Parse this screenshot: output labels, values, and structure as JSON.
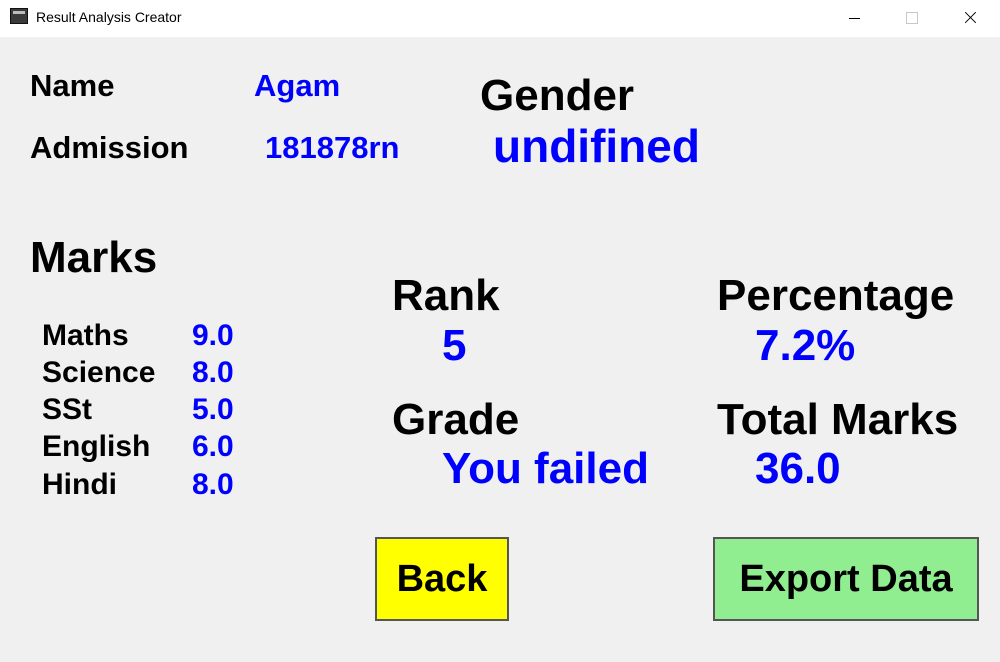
{
  "window": {
    "title": "Result Analysis Creator"
  },
  "student": {
    "name_label": "Name",
    "name_value": "Agam",
    "admission_label": "Admission",
    "admission_value": "181878rn",
    "gender_label": "Gender",
    "gender_value": "undifined"
  },
  "marks": {
    "heading": "Marks",
    "subjects": [
      {
        "name": "Maths",
        "score": "9.0"
      },
      {
        "name": "Science",
        "score": "8.0"
      },
      {
        "name": "SSt",
        "score": "5.0"
      },
      {
        "name": "English",
        "score": "6.0"
      },
      {
        "name": "Hindi",
        "score": "8.0"
      }
    ]
  },
  "results": {
    "rank_label": "Rank",
    "rank_value": "5",
    "percentage_label": "Percentage",
    "percentage_value": "7.2%",
    "grade_label": "Grade",
    "grade_value": "You failed",
    "total_label": "Total Marks",
    "total_value": "36.0"
  },
  "buttons": {
    "back_label": "Back",
    "export_label": "Export Data"
  },
  "colors": {
    "value_text": "#0000ff",
    "back_button": "#ffff00",
    "export_button": "#90ee90",
    "background": "#f0f0f0"
  },
  "icons": {
    "app": "app-icon",
    "minimize": "minimize-icon",
    "maximize": "maximize-icon",
    "close": "close-icon"
  }
}
